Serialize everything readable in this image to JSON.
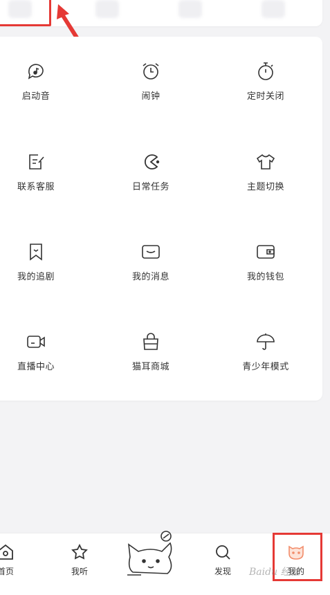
{
  "grid": {
    "items": [
      {
        "label": "启动音",
        "icon": "music-bubble-icon"
      },
      {
        "label": "闹钟",
        "icon": "alarm-clock-icon"
      },
      {
        "label": "定时关闭",
        "icon": "timer-icon"
      },
      {
        "label": "联系客服",
        "icon": "edit-note-icon"
      },
      {
        "label": "日常任务",
        "icon": "pacman-icon"
      },
      {
        "label": "主题切换",
        "icon": "tshirt-icon"
      },
      {
        "label": "我的追剧",
        "icon": "bookmark-icon"
      },
      {
        "label": "我的消息",
        "icon": "message-icon"
      },
      {
        "label": "我的钱包",
        "icon": "wallet-icon"
      },
      {
        "label": "直播中心",
        "icon": "video-camera-icon"
      },
      {
        "label": "猫耳商城",
        "icon": "shopping-bag-icon"
      },
      {
        "label": "青少年模式",
        "icon": "umbrella-icon"
      }
    ]
  },
  "nav": {
    "home": "首页",
    "listen": "我听",
    "discover": "发现",
    "mine": "我的"
  },
  "watermark": "Baidu 经验",
  "colors": {
    "highlight": "#e53935",
    "accent": "#f28c6a"
  }
}
